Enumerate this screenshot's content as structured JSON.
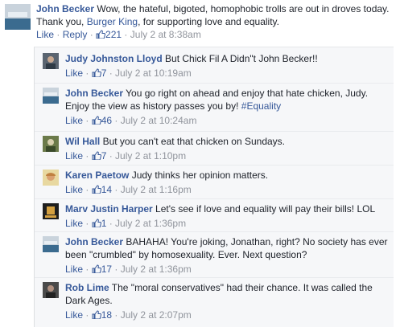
{
  "top_comment": {
    "author": "John Becker",
    "text_before": "Wow, the hateful, bigoted, homophobic trolls are out in droves today. Thank you,",
    "link": "Burger King",
    "text_after": ", for supporting love and equality.",
    "like_label": "Like",
    "reply_label": "Reply",
    "like_count": "221",
    "timestamp": "July 2 at 8:38am"
  },
  "replies": [
    {
      "author": "Judy Johnston Lloyd",
      "text": "But Chick Fil A Didn\"t John Becker!!",
      "like_label": "Like",
      "like_count": "7",
      "timestamp": "July 2 at 10:19am"
    },
    {
      "author": "John Becker",
      "text": "You go right on ahead and enjoy that hate chicken, Judy. Enjoy the view as history passes you by!",
      "hashtag": "#Equality",
      "like_label": "Like",
      "like_count": "46",
      "timestamp": "July 2 at 10:24am"
    },
    {
      "author": "Wil Hall",
      "text": "But you can't eat that chicken on Sundays.",
      "like_label": "Like",
      "like_count": "7",
      "timestamp": "July 2 at 1:10pm"
    },
    {
      "author": "Karen Paetow",
      "text": "Judy thinks her opinion matters.",
      "like_label": "Like",
      "like_count": "14",
      "timestamp": "July 2 at 1:16pm"
    },
    {
      "author": "Marv Justin Harper",
      "text": "Let's see if love and equality will pay their bills! LOL",
      "like_label": "Like",
      "like_count": "1",
      "timestamp": "July 2 at 1:36pm"
    },
    {
      "author": "John Becker",
      "text": "BAHAHA! You're joking, Jonathan, right? No society has ever been \"crumbled\" by homosexuality. Ever. Next question?",
      "like_label": "Like",
      "like_count": "17",
      "timestamp": "July 2 at 1:36pm"
    },
    {
      "author": "Rob Lime",
      "text": "The \"moral conservatives\" had their chance. It was called the Dark Ages.",
      "like_label": "Like",
      "like_count": "18",
      "timestamp": "July 2 at 2:07pm"
    }
  ],
  "colors": {
    "link": "#365899",
    "meta": "#90949c",
    "thread_bg": "#f6f7f9"
  }
}
